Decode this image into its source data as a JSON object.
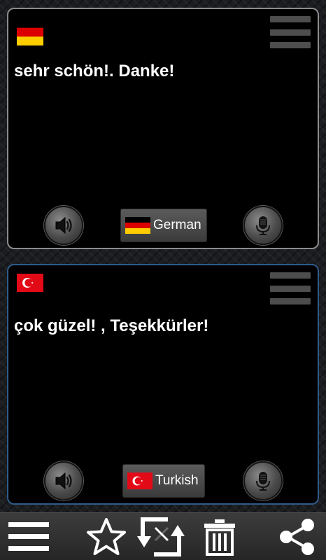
{
  "top_panel": {
    "phrase": "sehr schön!. Danke!",
    "language_label": "German",
    "flag": "germany-flag",
    "border_color": "#8c8c8c"
  },
  "bottom_panel": {
    "phrase": "çok güzel! , Teşekkürler!",
    "language_label": "Turkish",
    "flag": "turkey-flag",
    "border_color": "#2f5b8a"
  },
  "toolbar": {
    "items": [
      "menu-icon",
      "star-icon",
      "swap-icon",
      "trash-icon",
      "share-icon"
    ]
  },
  "colors": {
    "panel_bg": "#000000",
    "text": "#ffffff",
    "toolbar_bg": "#333333",
    "icon": "#ffffff"
  }
}
